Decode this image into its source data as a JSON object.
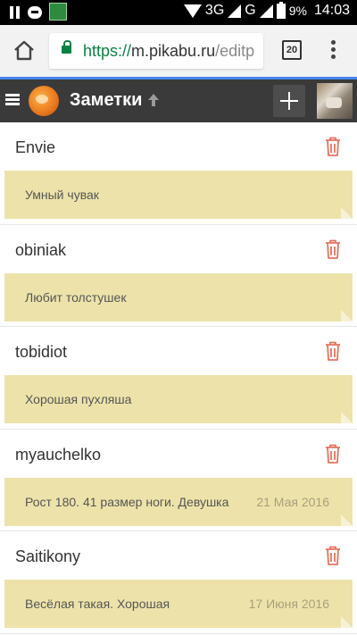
{
  "status_bar": {
    "network": "3G",
    "network2": "G",
    "battery": "9%",
    "time": "14:03"
  },
  "browser": {
    "url_scheme": "https://",
    "url_host": "m.pikabu.ru",
    "url_path": "/editp",
    "tab_count": "20"
  },
  "header": {
    "title": "Заметки"
  },
  "notes": [
    {
      "name": "Envie",
      "text": "Умный чувак",
      "date": ""
    },
    {
      "name": "obiniak",
      "text": "Любит толстушек",
      "date": ""
    },
    {
      "name": "tobidiot",
      "text": "Хорошая пухляша",
      "date": ""
    },
    {
      "name": "myauchelko",
      "text": "Рост 180. 41 размер ноги. Девушка",
      "date": "21 Мая 2016"
    },
    {
      "name": "Saitikony",
      "text": "Весёлая такая. Хорошая",
      "date": "17 Июня 2016"
    }
  ],
  "colors": {
    "note_bg": "#ede3aa",
    "trash": "#e5735f",
    "header_bg": "#3a3a3a",
    "url_green": "#0b8043",
    "progress_blue": "#4285f4"
  },
  "icons": [
    "pause-icon",
    "chat-icon",
    "app-icon",
    "wifi-icon",
    "signal-icon",
    "battery-icon",
    "home-icon",
    "lock-icon",
    "tabs-icon",
    "overflow-menu-icon",
    "hamburger-icon",
    "pikabu-logo",
    "arrow-up-icon",
    "plus-icon",
    "avatar",
    "trash-icon"
  ]
}
